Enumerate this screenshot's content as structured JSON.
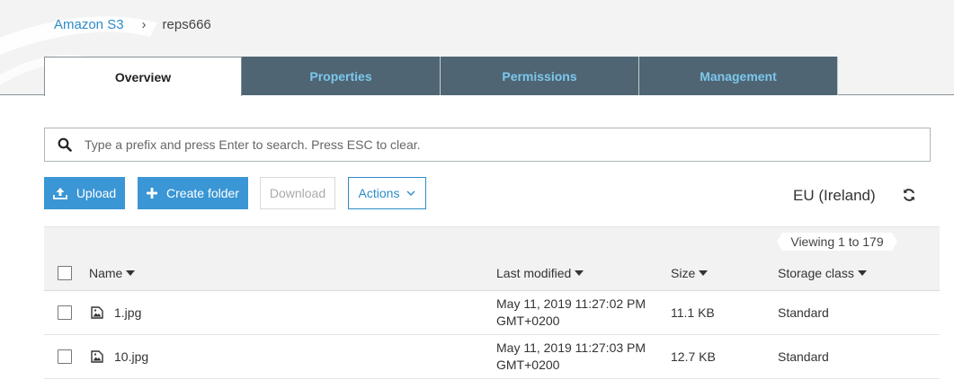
{
  "breadcrumb": {
    "root": "Amazon S3",
    "separator": "›",
    "current": "reps666"
  },
  "tabs": [
    {
      "label": "Overview",
      "active": true
    },
    {
      "label": "Properties",
      "active": false
    },
    {
      "label": "Permissions",
      "active": false
    },
    {
      "label": "Management",
      "active": false
    }
  ],
  "search": {
    "placeholder": "Type a prefix and press Enter to search. Press ESC to clear.",
    "value": "",
    "icon": "search-icon"
  },
  "toolbar": {
    "upload_label": "Upload",
    "create_folder_label": "Create folder",
    "download_label": "Download",
    "actions_label": "Actions",
    "region": "EU (Ireland)"
  },
  "pagination": {
    "viewing": "Viewing 1 to 179"
  },
  "table": {
    "columns": {
      "name": "Name",
      "modified": "Last modified",
      "size": "Size",
      "storage": "Storage class"
    },
    "rows": [
      {
        "name": "1.jpg",
        "modified_line1": "May 11, 2019 11:27:02 PM",
        "modified_line2": "GMT+0200",
        "size": "11.1 KB",
        "storage": "Standard"
      },
      {
        "name": "10.jpg",
        "modified_line1": "May 11, 2019 11:27:03 PM",
        "modified_line2": "GMT+0200",
        "size": "12.7 KB",
        "storage": "Standard"
      }
    ]
  },
  "colors": {
    "accent": "#3a96d5",
    "tab_bg": "#4f6573",
    "tab_text": "#7cc7ec",
    "link": "#2e8bc8"
  }
}
